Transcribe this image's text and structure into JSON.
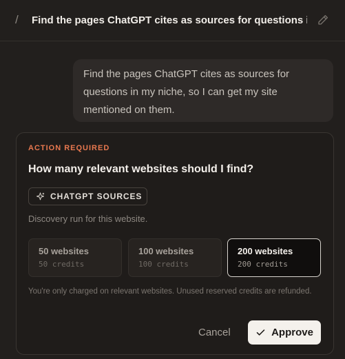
{
  "header": {
    "separator": "/",
    "title": "Find the pages ChatGPT cites as sources for questions i..."
  },
  "message": {
    "text": "Find the pages ChatGPT cites as sources for questions in my niche, so I can get my site mentioned on them."
  },
  "card": {
    "status": "ACTION REQUIRED",
    "question": "How many relevant websites should I find?",
    "chip_label": "CHATGPT SOURCES",
    "subtitle": "Discovery run for this website.",
    "options": [
      {
        "name": "50 websites",
        "credits": "50 credits",
        "selected": false
      },
      {
        "name": "100 websites",
        "credits": "100 credits",
        "selected": false
      },
      {
        "name": "200 websites",
        "credits": "200 credits",
        "selected": true
      }
    ],
    "note": "You're only charged on relevant websites. Unused reserved credits are refunded.",
    "cancel_label": "Cancel",
    "approve_label": "Approve"
  },
  "colors": {
    "accent": "#e8784f",
    "background": "#221f1d"
  }
}
